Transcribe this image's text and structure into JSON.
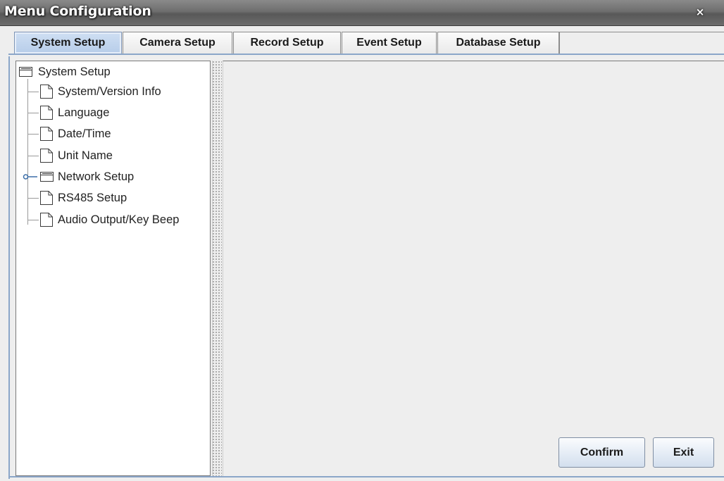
{
  "window": {
    "title": "Menu Configuration",
    "close_glyph": "×"
  },
  "tabs": [
    {
      "label": "System Setup",
      "active": true
    },
    {
      "label": "Camera Setup",
      "active": false
    },
    {
      "label": "Record Setup",
      "active": false
    },
    {
      "label": "Event Setup",
      "active": false
    },
    {
      "label": "Database Setup",
      "active": false
    }
  ],
  "tree": {
    "root": {
      "label": "System Setup",
      "icon": "folder-icon"
    },
    "items": [
      {
        "label": "System/Version Info",
        "icon": "document-icon"
      },
      {
        "label": "Language",
        "icon": "document-icon"
      },
      {
        "label": "Date/Time",
        "icon": "document-icon"
      },
      {
        "label": "Unit Name",
        "icon": "document-icon"
      },
      {
        "label": "Network Setup",
        "icon": "folder-icon",
        "collapsed": true
      },
      {
        "label": "RS485 Setup",
        "icon": "document-icon"
      },
      {
        "label": "Audio Output/Key Beep",
        "icon": "document-icon"
      }
    ]
  },
  "buttons": {
    "confirm_label": "Confirm",
    "exit_label": "Exit"
  },
  "colors": {
    "titlebar": "#6e6e6e",
    "active_tab": "#c4d7ee",
    "accent_border": "#8ba6c9",
    "panel_bg": "#eeeeee"
  }
}
